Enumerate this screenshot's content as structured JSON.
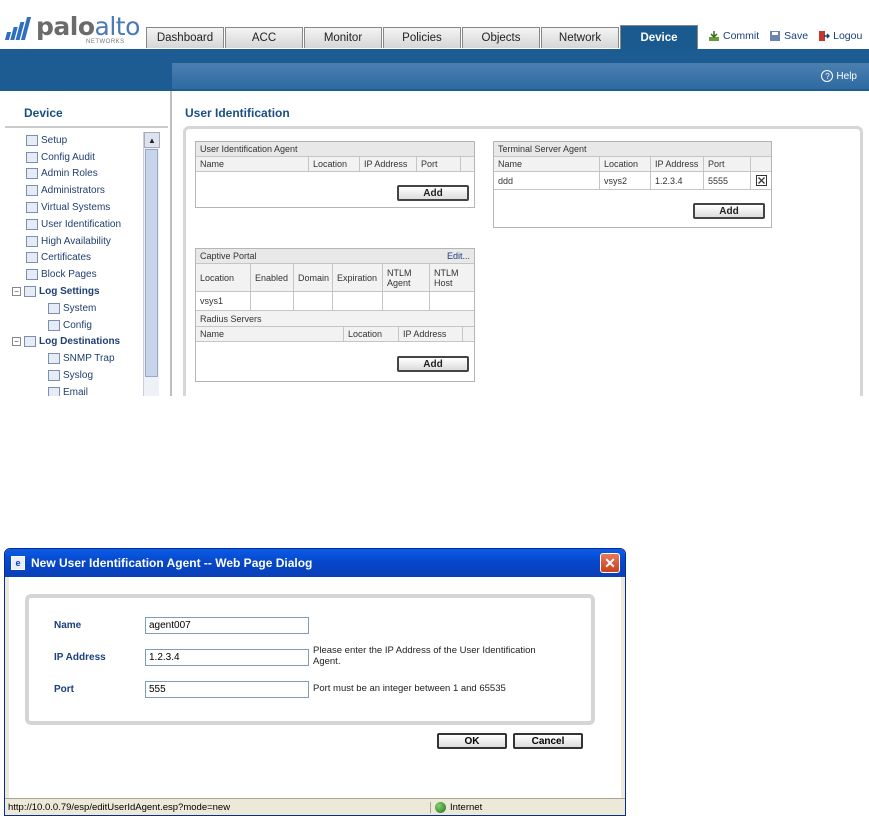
{
  "logo": {
    "brand_part1": "palo",
    "brand_part2": "alto",
    "sub": "NETWORKS"
  },
  "tabs": [
    "Dashboard",
    "ACC",
    "Monitor",
    "Policies",
    "Objects",
    "Network",
    "Device"
  ],
  "active_tab": "Device",
  "top_actions": {
    "commit": "Commit",
    "save": "Save",
    "logout": "Logou"
  },
  "help": "Help",
  "left": {
    "title": "Device",
    "tree": [
      {
        "label": "Setup",
        "level": 1
      },
      {
        "label": "Config Audit",
        "level": 1
      },
      {
        "label": "Admin Roles",
        "level": 1
      },
      {
        "label": "Administrators",
        "level": 1
      },
      {
        "label": "Virtual Systems",
        "level": 1
      },
      {
        "label": "User Identification",
        "level": 1
      },
      {
        "label": "High Availability",
        "level": 1
      },
      {
        "label": "Certificates",
        "level": 1
      },
      {
        "label": "Block Pages",
        "level": 1
      },
      {
        "label": "Log Settings",
        "level": 0
      },
      {
        "label": "System",
        "level": 2
      },
      {
        "label": "Config",
        "level": 2
      },
      {
        "label": "Log Destinations",
        "level": 0
      },
      {
        "label": "SNMP Trap",
        "level": 2
      },
      {
        "label": "Syslog",
        "level": 2
      },
      {
        "label": "Email",
        "level": 2
      }
    ]
  },
  "main": {
    "title": "User Identification",
    "uia": {
      "title": "User Identification Agent",
      "columns": [
        "Name",
        "Location",
        "IP Address",
        "Port"
      ],
      "add": "Add"
    },
    "tsa": {
      "title": "Terminal Server Agent",
      "columns": [
        "Name",
        "Location",
        "IP Address",
        "Port"
      ],
      "row": {
        "name": "ddd",
        "location": "vsys2",
        "ip": "1.2.3.4",
        "port": "5555"
      },
      "add": "Add"
    },
    "captive": {
      "title": "Captive Portal",
      "edit": "Edit...",
      "columns": [
        "Location",
        "Enabled",
        "Domain",
        "Expiration",
        "NTLM Agent",
        "NTLM Host"
      ],
      "row_location": "vsys1",
      "radius_title": "Radius Servers",
      "radius_columns": [
        "Name",
        "Location",
        "IP Address"
      ],
      "add": "Add"
    }
  },
  "dialog": {
    "title": "New User Identification Agent -- Web Page Dialog",
    "fields": {
      "name_label": "Name",
      "name_value": "agent007",
      "ip_label": "IP Address",
      "ip_value": "1.2.3.4",
      "ip_help": "Please enter the IP Address of the User Identification Agent.",
      "port_label": "Port",
      "port_value": "555",
      "port_help": "Port must be an integer between 1 and 65535"
    },
    "ok": "OK",
    "cancel": "Cancel",
    "status_url": "http://10.0.0.79/esp/editUserIdAgent.esp?mode=new",
    "status_zone": "Internet"
  }
}
